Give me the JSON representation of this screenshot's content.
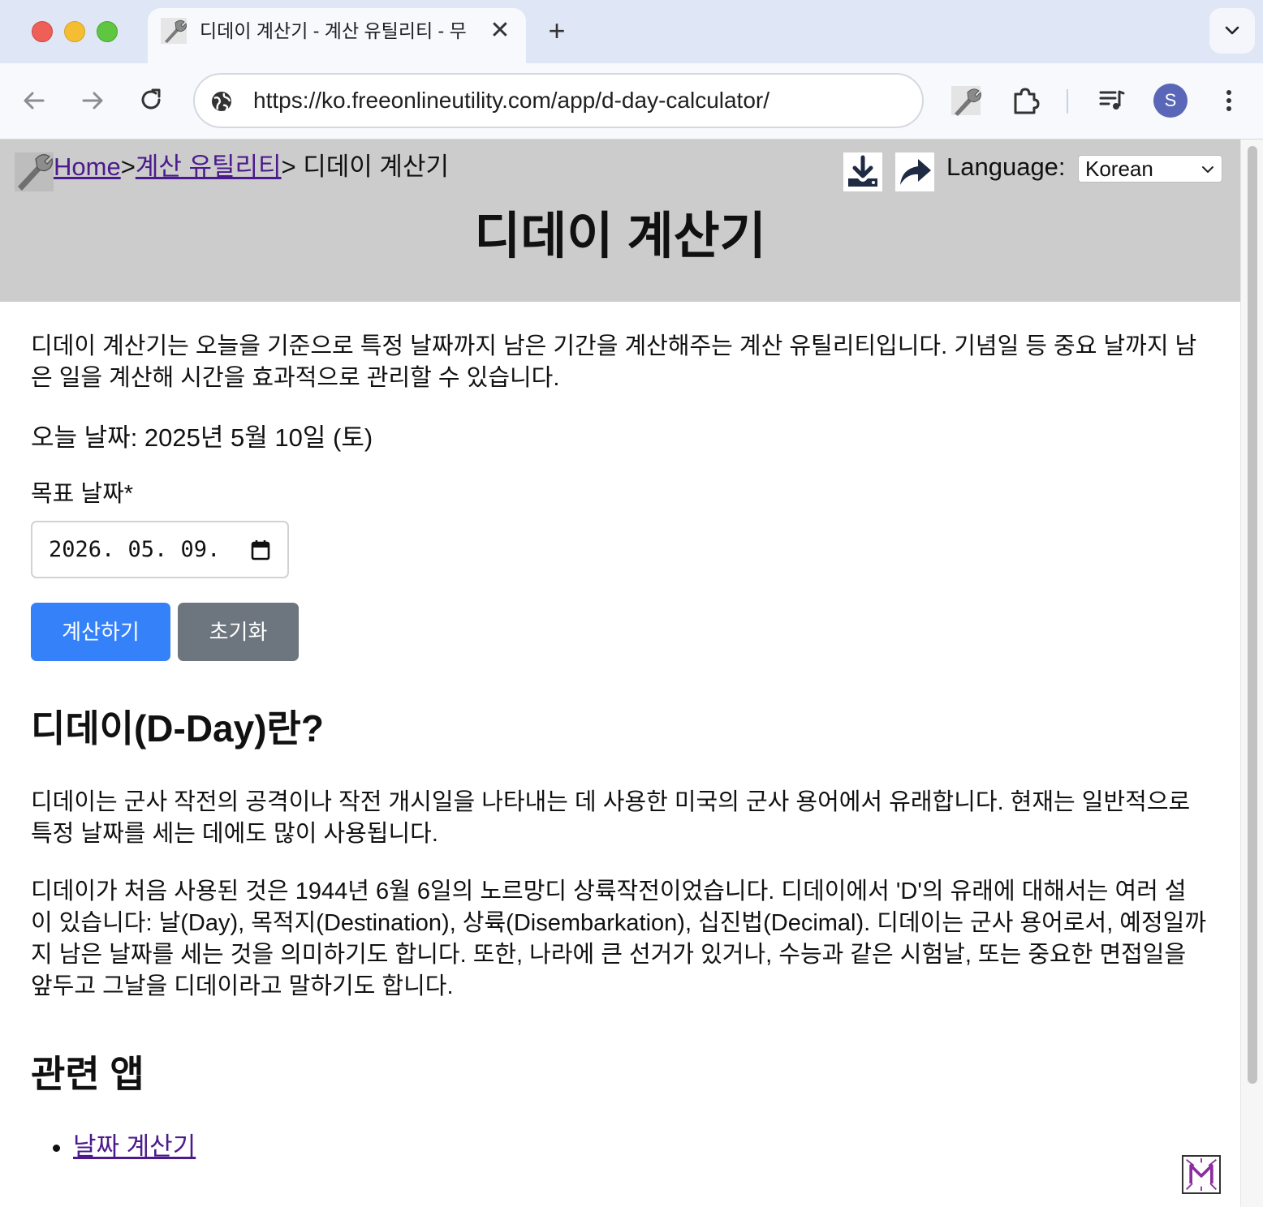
{
  "browser": {
    "tab_title": "디데이 계산기 - 계산 유틸리티 - 무",
    "tab_close": "✕",
    "new_tab": "+",
    "url": "https://ko.freeonlineutility.com/app/d-day-calculator/",
    "profile_initial": "S"
  },
  "header": {
    "breadcrumb_home": "Home",
    "breadcrumb_sep": ">",
    "breadcrumb_category": "계산 유틸리티",
    "breadcrumb_current": "> 디데이 계산기",
    "language_label": "Language:",
    "language_value": "Korean",
    "page_title": "디데이 계산기"
  },
  "main": {
    "intro": "디데이 계산기는 오늘을 기준으로 특정 날짜까지 남은 기간을 계산해주는 계산 유틸리티입니다. 기념일 등 중요 날까지 남은 일을 계산해 시간을 효과적으로 관리할 수 있습니다.",
    "today": "오늘 날짜: 2025년 5월 10일 (토)",
    "target_label": "목표 날짜*",
    "target_value": "2026. 05. 09.",
    "calculate_label": "계산하기",
    "reset_label": "초기화"
  },
  "about": {
    "heading": "디데이(D-Day)란?",
    "para1": "디데이는 군사 작전의 공격이나 작전 개시일을 나타내는 데 사용한 미국의 군사 용어에서 유래합니다. 현재는 일반적으로 특정 날짜를 세는 데에도 많이 사용됩니다.",
    "para2": "디데이가 처음 사용된 것은 1944년 6월 6일의 노르망디 상륙작전이었습니다. 디데이에서 'D'의 유래에 대해서는 여러 설이 있습니다: 날(Day), 목적지(Destination), 상륙(Disembarkation), 십진법(Decimal). 디데이는 군사 용어로서, 예정일까지 남은 날짜를 세는 것을 의미하기도 합니다. 또한, 나라에 큰 선거가 있거나, 수능과 같은 시험날, 또는 중요한 면접일을 앞두고 그날을 디데이라고 말하기도 합니다."
  },
  "related": {
    "heading": "관련 앱",
    "items": [
      {
        "label": "날짜 계산기"
      }
    ]
  },
  "colors": {
    "primary": "#3481fa",
    "secondary": "#6d757e",
    "header_bg": "#cccccc",
    "link": "#4b1b8c"
  },
  "icons": {
    "download": "download-icon",
    "share": "share-icon",
    "calendar": "calendar-icon",
    "logo": "wrench-logo-icon"
  }
}
